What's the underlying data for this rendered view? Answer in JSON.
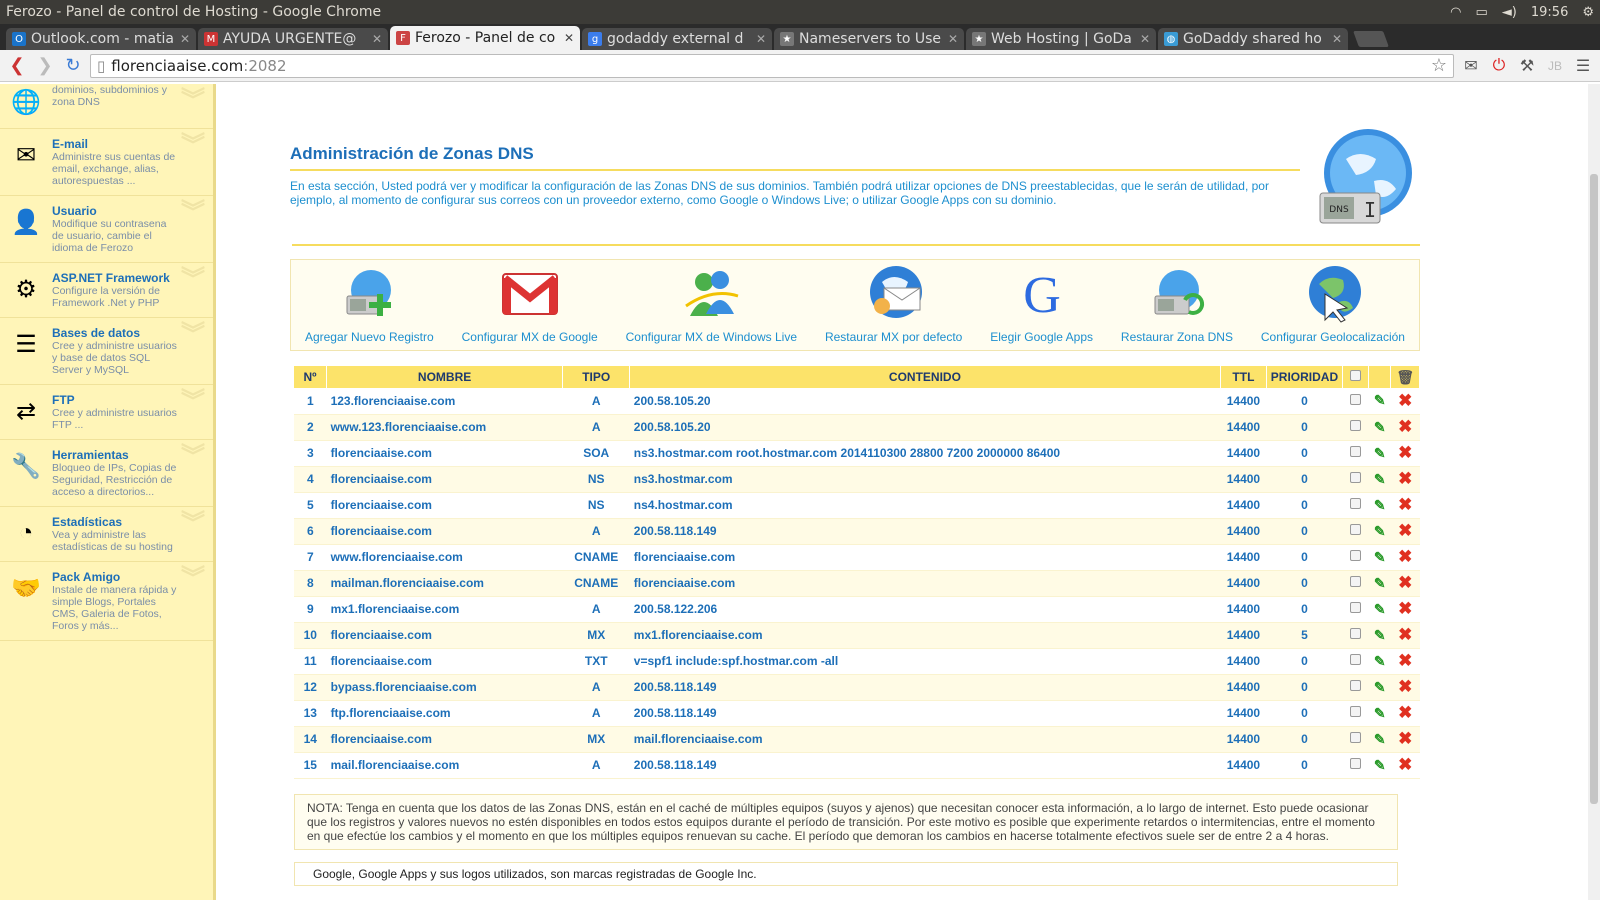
{
  "os": {
    "window_title": "Ferozo - Panel de control de Hosting - Google Chrome",
    "time": "19:56"
  },
  "browser": {
    "tabs": [
      {
        "label": "Outlook.com - matia",
        "favicon_color": "#1a73c9",
        "favicon": "O"
      },
      {
        "label": "AYUDA URGENTE@",
        "favicon_color": "#c33",
        "favicon": "M"
      },
      {
        "label": "Ferozo - Panel de co",
        "favicon_color": "#c44",
        "favicon": "F",
        "active": true
      },
      {
        "label": "godaddy external d",
        "favicon_color": "#3b7ded",
        "favicon": "g"
      },
      {
        "label": "Nameservers to Use",
        "favicon_color": "#777",
        "favicon": "★"
      },
      {
        "label": "Web Hosting | GoDa",
        "favicon_color": "#777",
        "favicon": "★"
      },
      {
        "label": "GoDaddy shared ho",
        "favicon_color": "#3a9bd5",
        "favicon": "◍"
      }
    ],
    "url_host": "florenciaaise.com",
    "url_port": ":2082"
  },
  "sidebar": {
    "items": [
      {
        "title": "",
        "desc": "dominios, subdominios y zona DNS",
        "icon": "globe-icon",
        "glyph": "🌐"
      },
      {
        "title": "E-mail",
        "desc": "Administre sus cuentas de email, exchange, alias, autorespuestas ...",
        "icon": "envelope-icon",
        "glyph": "✉"
      },
      {
        "title": "Usuario",
        "desc": "Modifique su contrasena de usuario, cambie el idioma de Ferozo",
        "icon": "user-icon",
        "glyph": "👤"
      },
      {
        "title": "ASP.NET Framework",
        "desc": "Configure la versión de Framework .Net y PHP",
        "icon": "gear-icon",
        "glyph": "⚙"
      },
      {
        "title": "Bases de datos",
        "desc": "Cree y administre usuarios y base de datos SQL Server y MySQL",
        "icon": "database-icon",
        "glyph": "☰"
      },
      {
        "title": "FTP",
        "desc": "Cree y administre usuarios FTP ...",
        "icon": "transfer-icon",
        "glyph": "⇄"
      },
      {
        "title": "Herramientas",
        "desc": "Bloqueo de IPs, Copias de Seguridad, Restricción de acceso a directorios...",
        "icon": "wrench-icon",
        "glyph": "🔧"
      },
      {
        "title": "Estadísticas",
        "desc": "Vea y administre las estadísticas de su hosting",
        "icon": "pie-chart-icon",
        "glyph": "◔"
      },
      {
        "title": "Pack Amigo",
        "desc": "Instale de manera rápida y simple Blogs, Portales CMS, Galeria de Fotos, Foros y más...",
        "icon": "handshake-icon",
        "glyph": "🤝"
      }
    ]
  },
  "main": {
    "title": "Administración de Zonas DNS",
    "intro": "En esta sección, Usted podrá ver y modificar la configuración de las Zonas DNS de sus dominios. También podrá utilizar opciones de DNS preestablecidas, que le serán de utilidad, por ejemplo, al momento de configurar sus correos con un proveedor externo, como Google o Windows Live; o utilizar Google Apps con su dominio.",
    "dns_badge": "DNS",
    "actions": [
      {
        "label": "Agregar Nuevo Registro",
        "icon": "add-record-icon"
      },
      {
        "label": "Configurar MX de Google",
        "icon": "gmail-icon"
      },
      {
        "label": "Configurar MX de Windows Live",
        "icon": "windows-live-icon"
      },
      {
        "label": "Restaurar MX por defecto",
        "icon": "mail-globe-icon"
      },
      {
        "label": "Elegir Google Apps",
        "icon": "google-icon"
      },
      {
        "label": "Restaurar Zona DNS",
        "icon": "restore-zone-icon"
      },
      {
        "label": "Configurar Geolocalización",
        "icon": "geolocation-icon"
      }
    ],
    "table": {
      "headers": {
        "num": "Nº",
        "name": "NOMBRE",
        "type": "TIPO",
        "content": "CONTENIDO",
        "ttl": "TTL",
        "priority": "PRIORIDAD"
      },
      "rows": [
        {
          "n": "1",
          "name": "123.florenciaaise.com",
          "type": "A",
          "content": "200.58.105.20",
          "ttl": "14400",
          "prio": "0"
        },
        {
          "n": "2",
          "name": "www.123.florenciaaise.com",
          "type": "A",
          "content": "200.58.105.20",
          "ttl": "14400",
          "prio": "0"
        },
        {
          "n": "3",
          "name": "florenciaaise.com",
          "type": "SOA",
          "content": "ns3.hostmar.com root.hostmar.com 2014110300 28800 7200 2000000 86400",
          "ttl": "14400",
          "prio": "0"
        },
        {
          "n": "4",
          "name": "florenciaaise.com",
          "type": "NS",
          "content": "ns3.hostmar.com",
          "ttl": "14400",
          "prio": "0"
        },
        {
          "n": "5",
          "name": "florenciaaise.com",
          "type": "NS",
          "content": "ns4.hostmar.com",
          "ttl": "14400",
          "prio": "0"
        },
        {
          "n": "6",
          "name": "florenciaaise.com",
          "type": "A",
          "content": "200.58.118.149",
          "ttl": "14400",
          "prio": "0"
        },
        {
          "n": "7",
          "name": "www.florenciaaise.com",
          "type": "CNAME",
          "content": "florenciaaise.com",
          "ttl": "14400",
          "prio": "0"
        },
        {
          "n": "8",
          "name": "mailman.florenciaaise.com",
          "type": "CNAME",
          "content": "florenciaaise.com",
          "ttl": "14400",
          "prio": "0"
        },
        {
          "n": "9",
          "name": "mx1.florenciaaise.com",
          "type": "A",
          "content": "200.58.122.206",
          "ttl": "14400",
          "prio": "0"
        },
        {
          "n": "10",
          "name": "florenciaaise.com",
          "type": "MX",
          "content": "mx1.florenciaaise.com",
          "ttl": "14400",
          "prio": "5"
        },
        {
          "n": "11",
          "name": "florenciaaise.com",
          "type": "TXT",
          "content": "v=spf1 include:spf.hostmar.com -all",
          "ttl": "14400",
          "prio": "0"
        },
        {
          "n": "12",
          "name": "bypass.florenciaaise.com",
          "type": "A",
          "content": "200.58.118.149",
          "ttl": "14400",
          "prio": "0"
        },
        {
          "n": "13",
          "name": "ftp.florenciaaise.com",
          "type": "A",
          "content": "200.58.118.149",
          "ttl": "14400",
          "prio": "0"
        },
        {
          "n": "14",
          "name": "florenciaaise.com",
          "type": "MX",
          "content": "mail.florenciaaise.com",
          "ttl": "14400",
          "prio": "0"
        },
        {
          "n": "15",
          "name": "mail.florenciaaise.com",
          "type": "A",
          "content": "200.58.118.149",
          "ttl": "14400",
          "prio": "0"
        }
      ]
    },
    "note": "NOTA: Tenga en cuenta que los datos de las Zonas DNS, están en el caché de múltiples equipos (suyos y ajenos) que necesitan conocer esta información, a lo largo de internet. Esto puede ocasionar que los registros y valores nuevos no estén disponibles en todos estos equipos durante el período de transición. Por este motivo es posible que experimente retardos o intermitencias, entre el momento en que efectúe los cambios y el momento en que los múltiples equipos renuevan su cache. El período que demoran los cambios en hacerse totalmente efectivos suele ser de entre 2 a 4 horas.",
    "footer": "Google, Google Apps y sus logos utilizados, son marcas registradas de Google Inc."
  }
}
